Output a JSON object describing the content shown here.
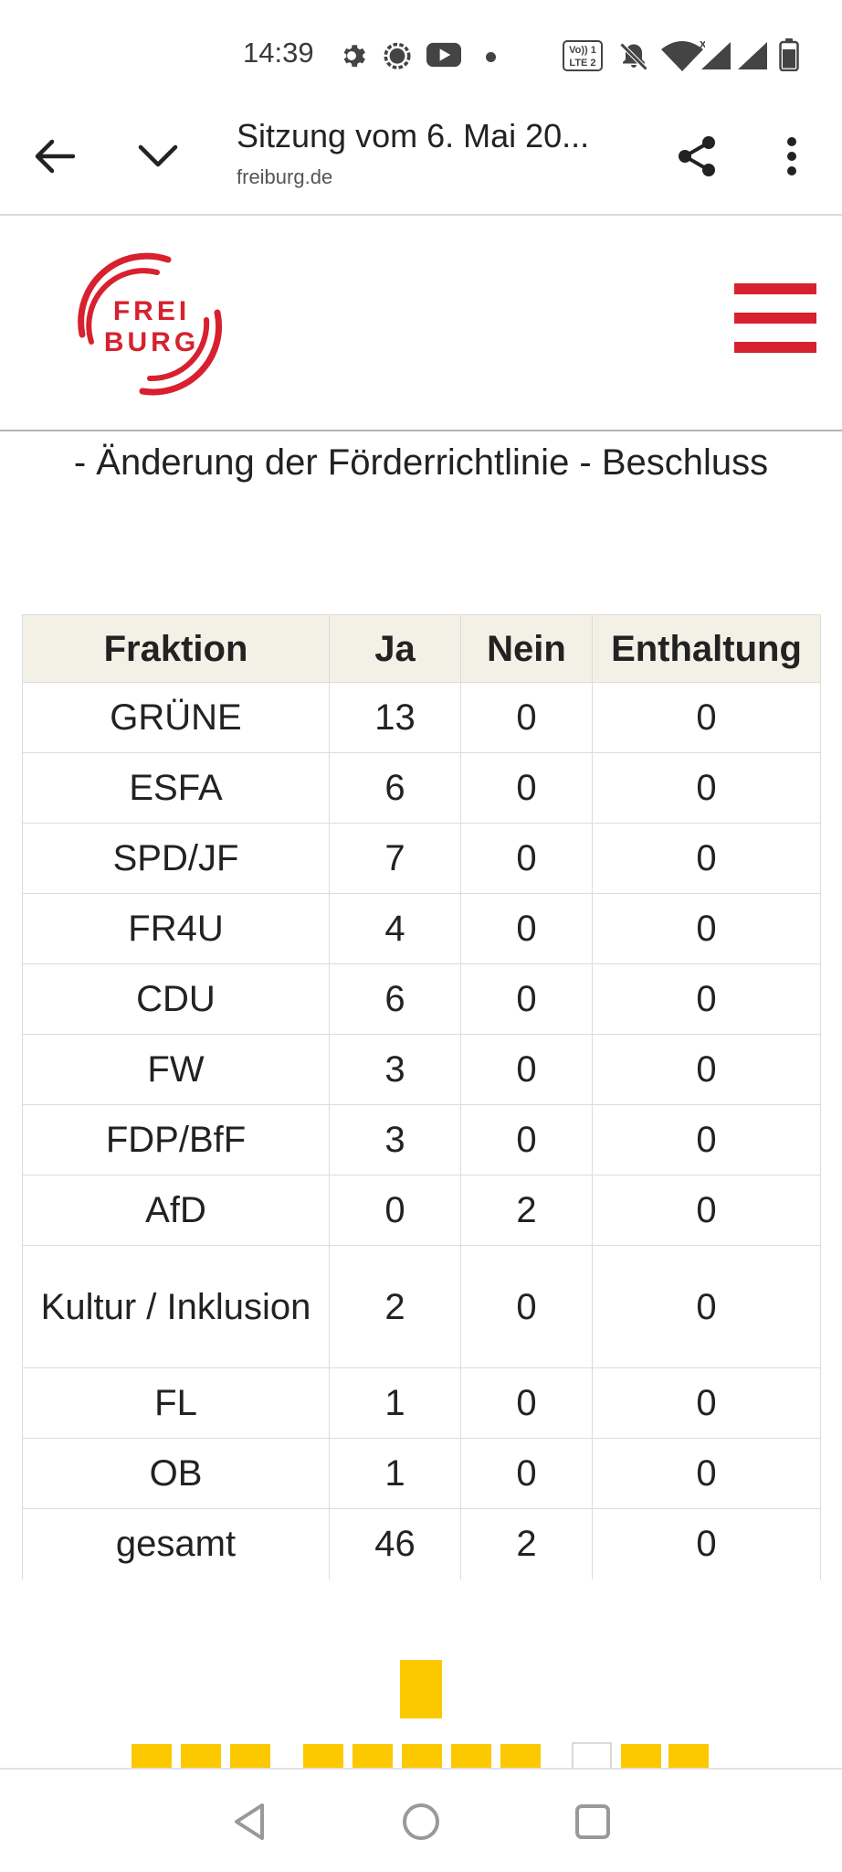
{
  "status_bar": {
    "time": "14:39",
    "icons": [
      "gear-icon",
      "chat-bubble-icon",
      "youtube-icon",
      "notification-dot-icon",
      "volte-icon",
      "bell-off-icon",
      "wifi-icon",
      "signal-icon",
      "signal-icon",
      "battery-icon"
    ],
    "volte_top": "Vo)) 1",
    "volte_bottom": "LTE 2"
  },
  "browser": {
    "title": "Sitzung vom 6. Mai 20...",
    "domain": "freiburg.de"
  },
  "site": {
    "logo_line1": "FREI",
    "logo_line2": "BURG",
    "brand_color": "#d7212e"
  },
  "content": {
    "subtitle": "- Änderung der Förderrichtlinie - Beschluss",
    "table": {
      "headers": [
        "Fraktion",
        "Ja",
        "Nein",
        "Enthaltung"
      ],
      "rows": [
        [
          "GRÜNE",
          "13",
          "0",
          "0"
        ],
        [
          "ESFA",
          "6",
          "0",
          "0"
        ],
        [
          "SPD/JF",
          "7",
          "0",
          "0"
        ],
        [
          "FR4U",
          "4",
          "0",
          "0"
        ],
        [
          "CDU",
          "6",
          "0",
          "0"
        ],
        [
          "FW",
          "3",
          "0",
          "0"
        ],
        [
          "FDP/BfF",
          "3",
          "0",
          "0"
        ],
        [
          "AfD",
          "0",
          "2",
          "0"
        ],
        [
          "Kultur / Inklusion",
          "2",
          "0",
          "0"
        ],
        [
          "FL",
          "1",
          "0",
          "0"
        ],
        [
          "OB",
          "1",
          "0",
          "0"
        ],
        [
          "gesamt",
          "46",
          "2",
          "0"
        ]
      ]
    }
  },
  "colors": {
    "accent_red": "#d7212e",
    "header_bg": "#f3f1e6",
    "block_yellow": "#fcc900"
  },
  "nav": {
    "buttons": [
      "back-triangle-icon",
      "home-circle-icon",
      "recents-square-icon"
    ]
  }
}
